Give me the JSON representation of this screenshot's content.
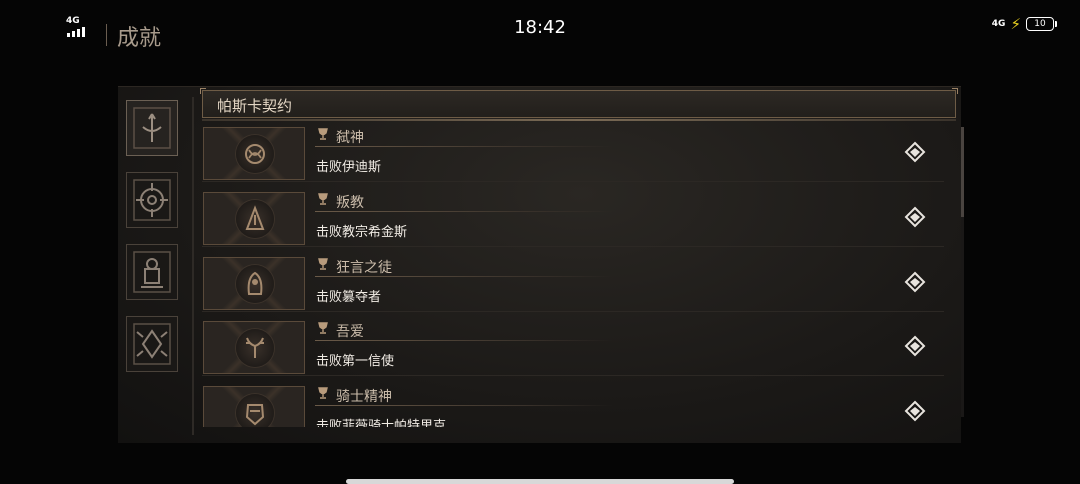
{
  "status": {
    "network_left": "4G",
    "time": "18:42",
    "network_right": "4G",
    "battery": "10"
  },
  "header": {
    "title": "成就"
  },
  "categories": [
    {
      "name": "trident-emblem-icon",
      "active": true
    },
    {
      "name": "crosshair-emblem-icon",
      "active": false
    },
    {
      "name": "lantern-emblem-icon",
      "active": false
    },
    {
      "name": "beetle-emblem-icon",
      "active": false
    }
  ],
  "section": {
    "title": "帕斯卡契约"
  },
  "achievements": [
    {
      "title": "弑神",
      "desc": "击败伊迪斯",
      "icon": "knot-medal-icon"
    },
    {
      "title": "叛教",
      "desc": "击败教宗希金斯",
      "icon": "spire-medal-icon"
    },
    {
      "title": "狂言之徒",
      "desc": "击败篡夺者",
      "icon": "hooded-figure-medal-icon"
    },
    {
      "title": "吾爱",
      "desc": "击败第一信使",
      "icon": "antlers-medal-icon"
    },
    {
      "title": "骑士精神",
      "desc": "击败菲薇骑士帕特里克",
      "icon": "helmet-medal-icon"
    }
  ],
  "colors": {
    "accent": "#8a7258",
    "panel": "#1b1917",
    "text_light": "#f0ebe4"
  }
}
